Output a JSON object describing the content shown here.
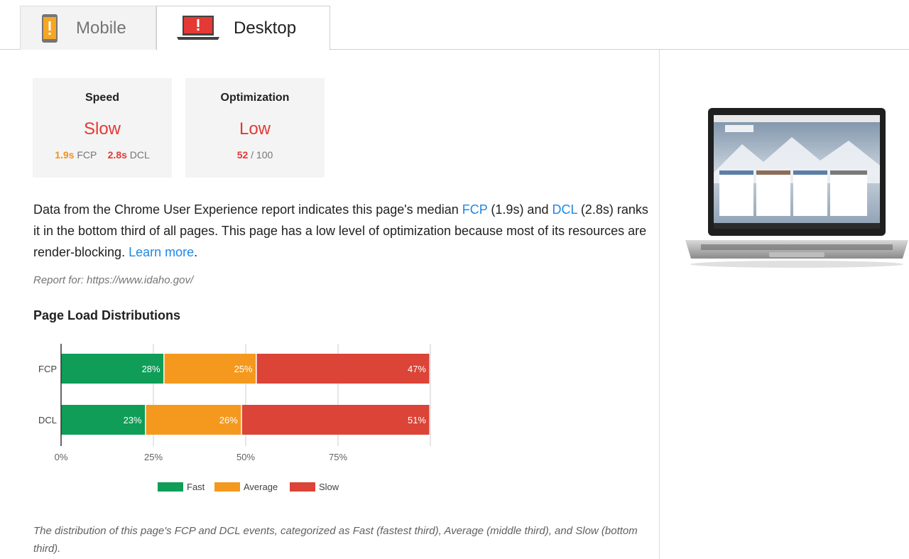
{
  "tabs": [
    {
      "label": "Mobile",
      "icon": "mobile-warning-icon",
      "icon_color": "#f6a623"
    },
    {
      "label": "Desktop",
      "icon": "desktop-warning-icon",
      "icon_color": "#e53935"
    }
  ],
  "speed_card": {
    "title": "Speed",
    "rating": "Slow",
    "fcp_value": "1.9s",
    "fcp_label": "FCP",
    "dcl_value": "2.8s",
    "dcl_label": "DCL"
  },
  "optimization_card": {
    "title": "Optimization",
    "rating": "Low",
    "score": "52",
    "max": "/ 100"
  },
  "description": {
    "part1": "Data from the Chrome User Experience report indicates this page's median ",
    "fcp_link": "FCP",
    "part2": " (1.9s) and ",
    "dcl_link": "DCL",
    "part3": " (2.8s) ranks it in the bottom third of all pages. This page has a low level of optimization because most of its resources are render-blocking. ",
    "learn_more": "Learn more",
    "part4": "."
  },
  "report_for": "Report for: https://www.idaho.gov/",
  "section_title": "Page Load Distributions",
  "chart_data": {
    "type": "bar",
    "orientation": "horizontal",
    "stacked": true,
    "categories": [
      "FCP",
      "DCL"
    ],
    "series": [
      {
        "name": "Fast",
        "color": "#0f9d58",
        "values": [
          28,
          23
        ]
      },
      {
        "name": "Average",
        "color": "#f4991e",
        "values": [
          25,
          26
        ]
      },
      {
        "name": "Slow",
        "color": "#db4437",
        "values": [
          47,
          51
        ]
      }
    ],
    "value_labels": [
      [
        "28%",
        "25%",
        "47%"
      ],
      [
        "23%",
        "26%",
        "51%"
      ]
    ],
    "x_ticks": [
      "0%",
      "25%",
      "50%",
      "75%"
    ],
    "tick_values": [
      0,
      25,
      50,
      75
    ],
    "xlim": [
      0,
      100
    ],
    "grid": true,
    "legend_position": "bottom"
  },
  "footnote": "The distribution of this page's FCP and DCL events, categorized as Fast (fastest third), Average (middle third), and Slow (bottom third).",
  "colors": {
    "slow": "#e53935",
    "average": "#f29121",
    "link": "#1e88e5"
  }
}
